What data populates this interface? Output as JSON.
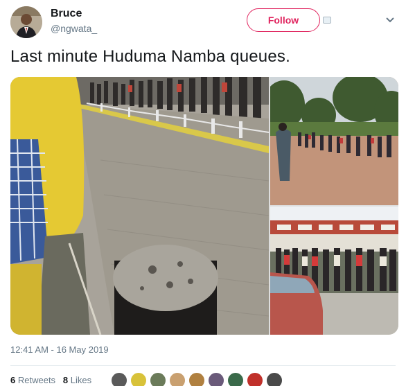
{
  "author": {
    "name": "Bruce",
    "handle": "@ngwata_",
    "avatar_icon": "profile-photo"
  },
  "follow": {
    "label": "Follow",
    "accent": "#e0245e"
  },
  "tweet": {
    "text": "Last minute Huduma Namba queues.",
    "timestamp": "12:41 AM - 16 May 2019"
  },
  "media": {
    "images": [
      {
        "name": "sidewalk-bollard-photo"
      },
      {
        "name": "dirt-field-queue-photo"
      },
      {
        "name": "building-queue-photo"
      }
    ]
  },
  "stats": {
    "retweets_count": "6",
    "retweets_label": "Retweets",
    "likes_count": "8",
    "likes_label": "Likes",
    "liker_colors": [
      "#5a5a5a",
      "#d8c23a",
      "#6b7b5a",
      "#c9a070",
      "#b08040",
      "#6a5a7a",
      "#3a6a4a",
      "#c0302a",
      "#4a4a4a"
    ]
  }
}
